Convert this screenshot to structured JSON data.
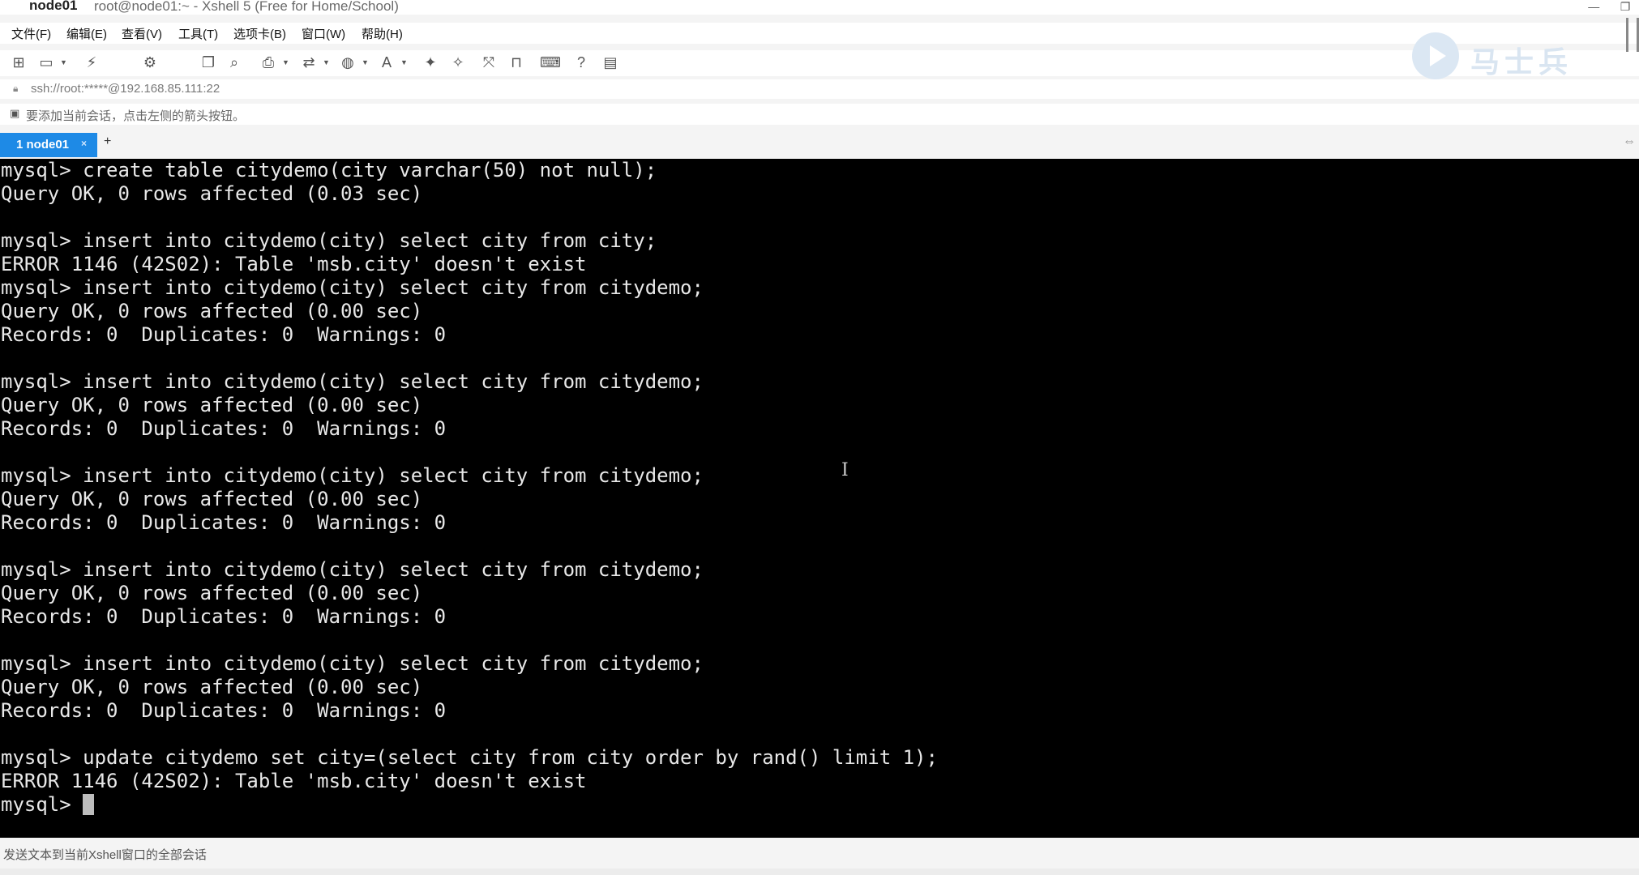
{
  "window": {
    "title": "node01",
    "subtitle": "root@node01:~ - Xshell 5 (Free for Home/School)",
    "minimize": "—",
    "maximize": "❐"
  },
  "menu": [
    {
      "label": "文件(F)"
    },
    {
      "label": "编辑(E)"
    },
    {
      "label": "查看(V)"
    },
    {
      "label": "工具(T)"
    },
    {
      "label": "选项卡(B)"
    },
    {
      "label": "窗口(W)"
    },
    {
      "label": "帮助(H)"
    }
  ],
  "toolbar_icons": [
    "new-session-icon",
    "open-folder-icon",
    "disconnect-icon",
    "properties-icon",
    "copy-icon",
    "find-icon",
    "print-icon",
    "transfer-icon",
    "globe-icon",
    "font-icon",
    "xftp-icon",
    "xagent-icon",
    "fullscreen-icon",
    "lock-icon",
    "keyboard-icon",
    "help-icon",
    "chat-icon"
  ],
  "logo": {
    "text": "马士兵"
  },
  "address": {
    "text": "ssh://root:*****@192.168.85.111:22"
  },
  "hint": {
    "text": "要添加当前会话，点击左侧的箭头按钮。"
  },
  "tabs": {
    "active": {
      "label": "1 node01",
      "close": "×"
    },
    "add": "+"
  },
  "terminal": {
    "lines": [
      "mysql> create table citydemo(city varchar(50) not null);",
      "Query OK, 0 rows affected (0.03 sec)",
      "",
      "mysql> insert into citydemo(city) select city from city;",
      "ERROR 1146 (42S02): Table 'msb.city' doesn't exist",
      "mysql> insert into citydemo(city) select city from citydemo;",
      "Query OK, 0 rows affected (0.00 sec)",
      "Records: 0  Duplicates: 0  Warnings: 0",
      "",
      "mysql> insert into citydemo(city) select city from citydemo;",
      "Query OK, 0 rows affected (0.00 sec)",
      "Records: 0  Duplicates: 0  Warnings: 0",
      "",
      "mysql> insert into citydemo(city) select city from citydemo;",
      "Query OK, 0 rows affected (0.00 sec)",
      "Records: 0  Duplicates: 0  Warnings: 0",
      "",
      "mysql> insert into citydemo(city) select city from citydemo;",
      "Query OK, 0 rows affected (0.00 sec)",
      "Records: 0  Duplicates: 0  Warnings: 0",
      "",
      "mysql> insert into citydemo(city) select city from citydemo;",
      "Query OK, 0 rows affected (0.00 sec)",
      "Records: 0  Duplicates: 0  Warnings: 0",
      "",
      "mysql> update citydemo set city=(select city from city order by rand() limit 1);",
      "ERROR 1146 (42S02): Table 'msb.city' doesn't exist"
    ],
    "prompt": "mysql> "
  },
  "status": {
    "text": "发送文本到当前Xshell窗口的全部会话"
  },
  "colors": {
    "tab_active": "#1e8ae6",
    "terminal_bg": "#000000",
    "terminal_fg": "#e8e8e8"
  }
}
